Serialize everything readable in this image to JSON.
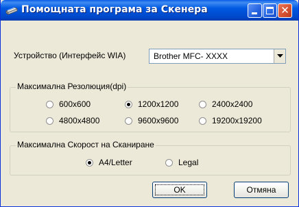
{
  "window": {
    "title": "Помощната програма за Скенера"
  },
  "device": {
    "label": "Устройство (Интерфейс WIA)",
    "selected": "Brother MFC- XXXX"
  },
  "resolution": {
    "legend": "Максимална Резолюция(dpi)",
    "options": [
      "600x600",
      "1200x1200",
      "2400x2400",
      "4800x4800",
      "9600x9600",
      "19200x19200"
    ],
    "selected": "1200x1200"
  },
  "speed": {
    "legend": "Максимална Скорост на Сканиране",
    "options": [
      "A4/Letter",
      "Legal"
    ],
    "selected": "A4/Letter"
  },
  "buttons": {
    "ok": "OK",
    "cancel": "Отмяна"
  }
}
